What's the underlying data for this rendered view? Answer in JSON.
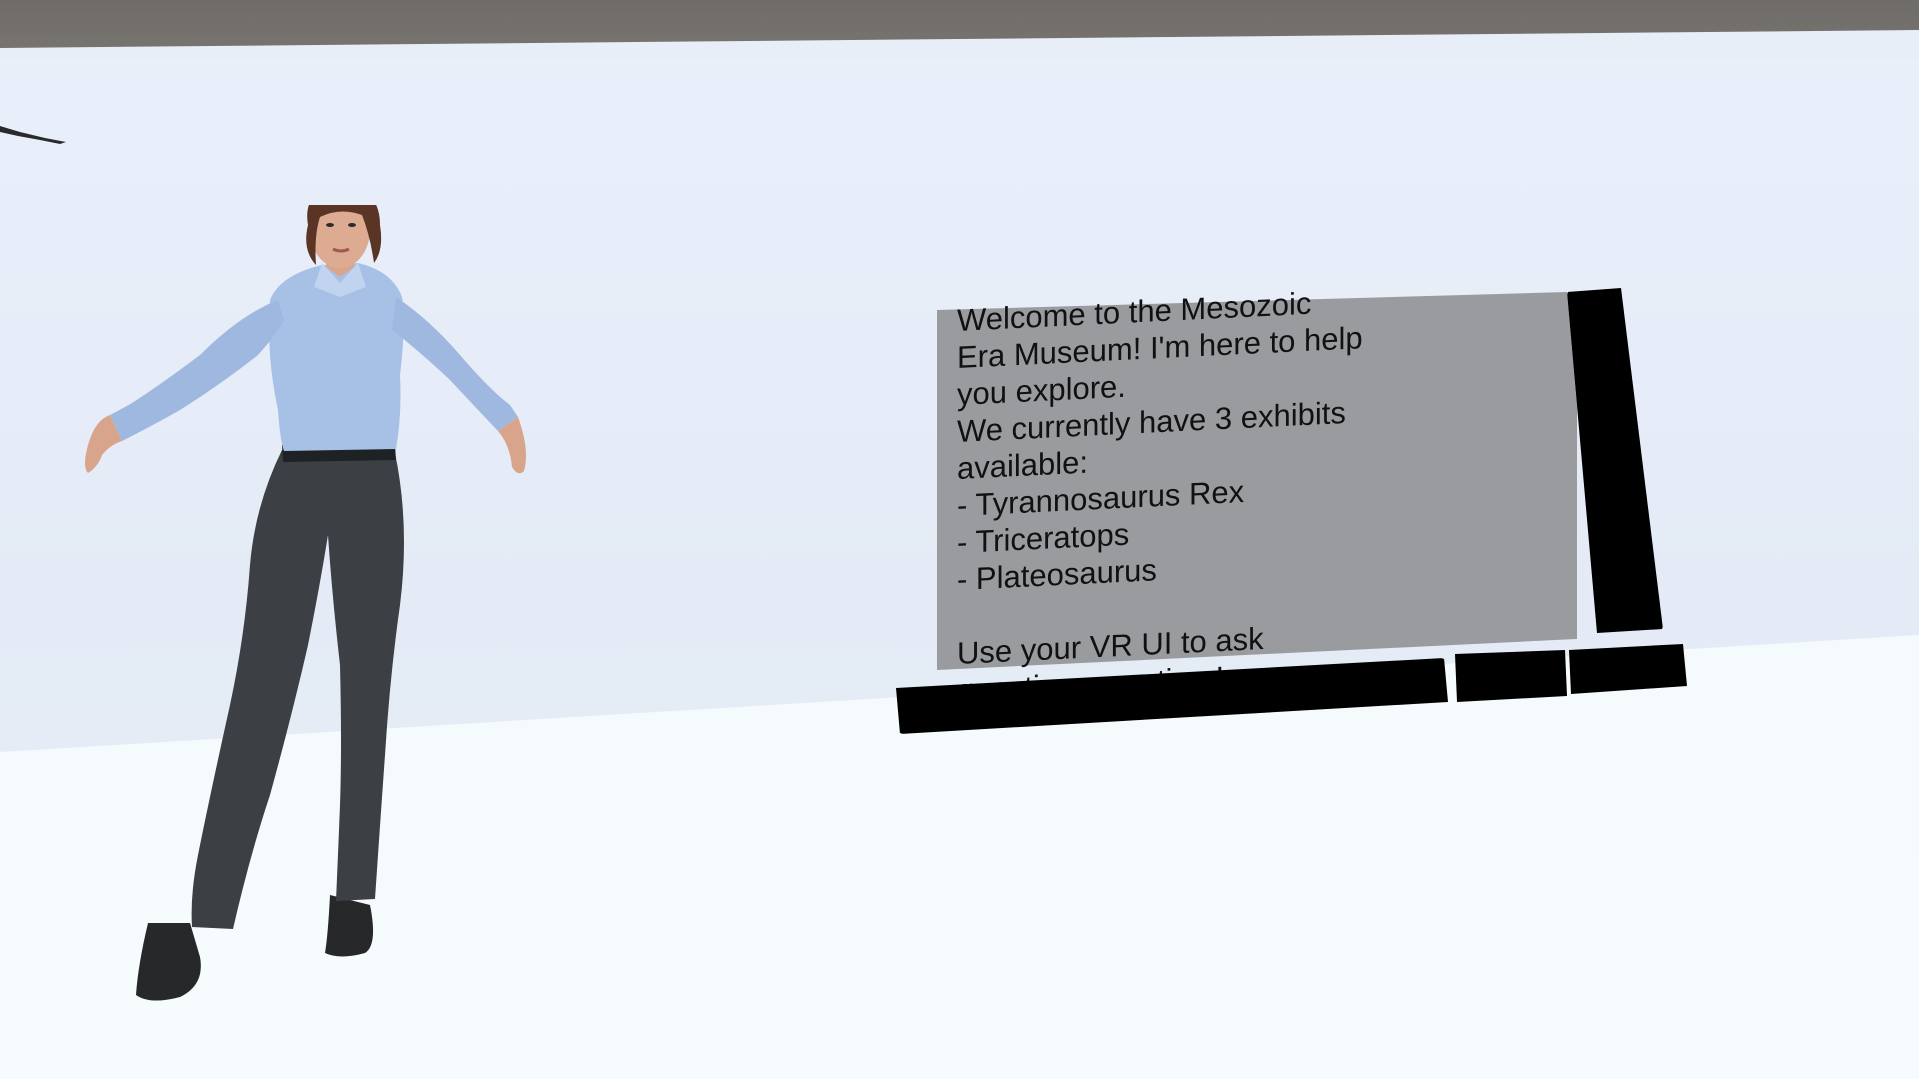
{
  "scene": {
    "colors": {
      "ceiling": "#727070",
      "wall": "#e8eef7",
      "floor": "#f5fbfd",
      "panel": "#999b9f",
      "ui_black": "#000000"
    }
  },
  "guide_panel": {
    "message": "Welcome to the Mesozoic\nEra Museum! I'm here to help\nyou explore.\nWe currently have 3 exhibits\navailable:\n- Tyrannosaurus Rex\n- Triceratops\n- Plateosaurus\n\nUse your VR UI to ask\nquestions any time!",
    "input_value": "",
    "button_a_label": "",
    "button_b_label": ""
  },
  "avatar": {
    "icon": "museum-guide-avatar"
  }
}
